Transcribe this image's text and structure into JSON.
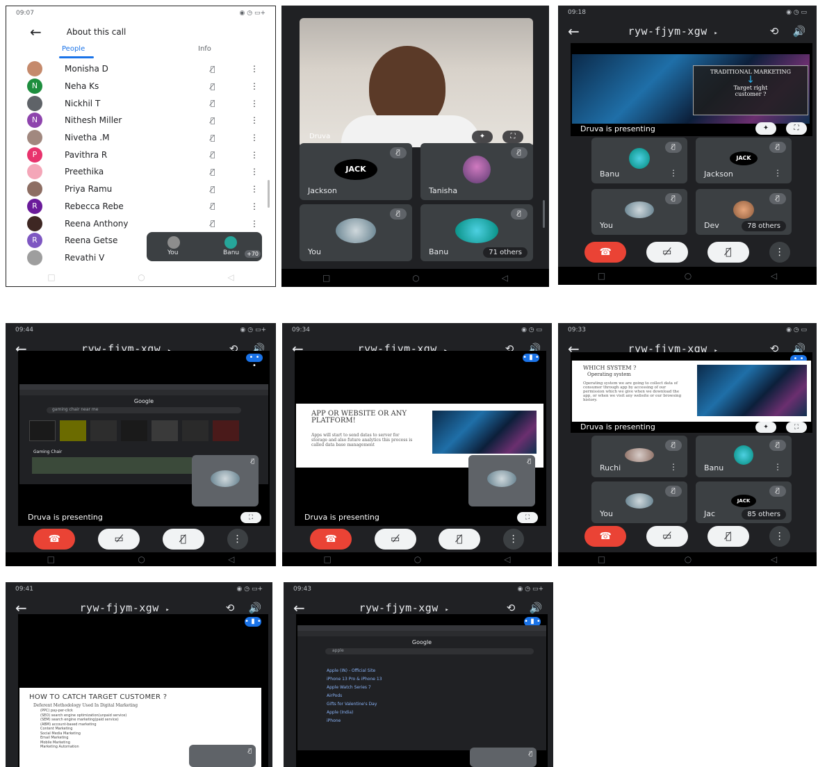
{
  "shot1": {
    "status_time": "09:07",
    "title": "About this call",
    "tabs": [
      "People",
      "Info"
    ],
    "people": [
      {
        "name": "Monisha D",
        "initial": "",
        "color": "#c58a6c"
      },
      {
        "name": "Neha Ks",
        "initial": "N",
        "color": "#1e8e3e"
      },
      {
        "name": "Nickhil T",
        "initial": "",
        "color": "#5f6368"
      },
      {
        "name": "Nithesh Miller",
        "initial": "N",
        "color": "#8e44ad"
      },
      {
        "name": "Nivetha .M",
        "initial": "",
        "color": "#a1887f"
      },
      {
        "name": "Pavithra R",
        "initial": "P",
        "color": "#e8336d"
      },
      {
        "name": "Preethika",
        "initial": "",
        "color": "#f4a6b8"
      },
      {
        "name": "Priya Ramu",
        "initial": "",
        "color": "#8d6e63"
      },
      {
        "name": "Rebecca Rebe",
        "initial": "R",
        "color": "#6a1b9a"
      },
      {
        "name": "Reena Anthony",
        "initial": "",
        "color": "#3e2723"
      },
      {
        "name": "Reena Getse",
        "initial": "R",
        "color": "#7e57c2"
      },
      {
        "name": "Revathi V",
        "initial": "",
        "color": "#9e9e9e"
      }
    ],
    "overlay_you": "You",
    "overlay_banu": "Banu",
    "overlay_count": "+70"
  },
  "shot2": {
    "main_name": "Druva",
    "tiles": [
      {
        "name": "Jackson",
        "avatar": "JACK"
      },
      {
        "name": "Tanisha",
        "avatar": ""
      },
      {
        "name": "You",
        "avatar": ""
      },
      {
        "name": "Banu",
        "avatar": "",
        "others": "71 others"
      }
    ]
  },
  "shot3": {
    "status_time": "09:18",
    "code": "ryw-fjym-xgw",
    "slide_heading": "TRADITIONAL MARKETING",
    "slide_sub": "Target right customer ?",
    "presenting": "Druva is presenting",
    "tiles": [
      {
        "name": "Banu",
        "avatar": ""
      },
      {
        "name": "Jackson",
        "avatar": "JACK"
      },
      {
        "name": "You",
        "avatar": ""
      },
      {
        "name": "Dev",
        "avatar": "",
        "others": "78 others"
      }
    ]
  },
  "shot4": {
    "status_time": "09:44",
    "code": "ryw-fjym-xgw",
    "browser_title": "Google",
    "search_text": "gaming chair near me",
    "section": "Gaming Chair",
    "presenting": "Druva is presenting"
  },
  "shot5": {
    "status_time": "09:34",
    "code": "ryw-fjym-xgw",
    "slide_heading": "APP OR WEBSITE OR ANY PLATFORM!",
    "slide_body": "Apps will start to send datas to server for storage and also future analytics this process is called data base management",
    "presenting": "Druva is presenting"
  },
  "shot6": {
    "status_time": "09:33",
    "code": "ryw-fjym-xgw",
    "slide_heading": "WHICH SYSTEM ?",
    "slide_sub": "Operating system",
    "slide_body": "Operating system we are going to collect data of consumer through app by accessing of our permission which we give when we download the app, or when we visit any website or our browsing history.",
    "presenting": "Druva is presenting",
    "tiles": [
      {
        "name": "Ruchi",
        "avatar": ""
      },
      {
        "name": "Banu",
        "avatar": ""
      },
      {
        "name": "You",
        "avatar": ""
      },
      {
        "name": "Jac",
        "avatar": "JACK",
        "others": "85 others"
      }
    ]
  },
  "shot7": {
    "status_time": "09:41",
    "code": "ryw-fjym-xgw",
    "slide_heading": "HOW TO CATCH TARGET CUSTOMER ?",
    "slide_sub": "Deferent Methodology Used In Digital Marketing",
    "bullets": [
      "(PPC) pay-per-click",
      "(SEO) search engine optimization(unpaid service)",
      "(SEM) search engine marketing(paid service)",
      "(ABM) account-based marketing",
      "Content Marketing",
      "Social Media Marketing",
      "Email Marketing",
      "Mobile Marketing",
      "Marketing Automation"
    ]
  },
  "shot8": {
    "status_time": "09:43",
    "code": "ryw-fjym-xgw",
    "browser_title": "Google",
    "search_text": "apple",
    "results": [
      "Apple (IN) - Official Site",
      "iPhone 13 Pro & iPhone 13",
      "Apple Watch Series 7",
      "AirPods",
      "Gifts for Valentine's Day",
      "Apple (India)",
      "iPhone"
    ]
  },
  "common": {
    "back": "←",
    "caret": "▸",
    "mic_off": "🎙̸",
    "more": "⋮",
    "cam_off": "▭̸",
    "end": "☎",
    "nav": [
      "□",
      "○",
      "◁"
    ]
  }
}
